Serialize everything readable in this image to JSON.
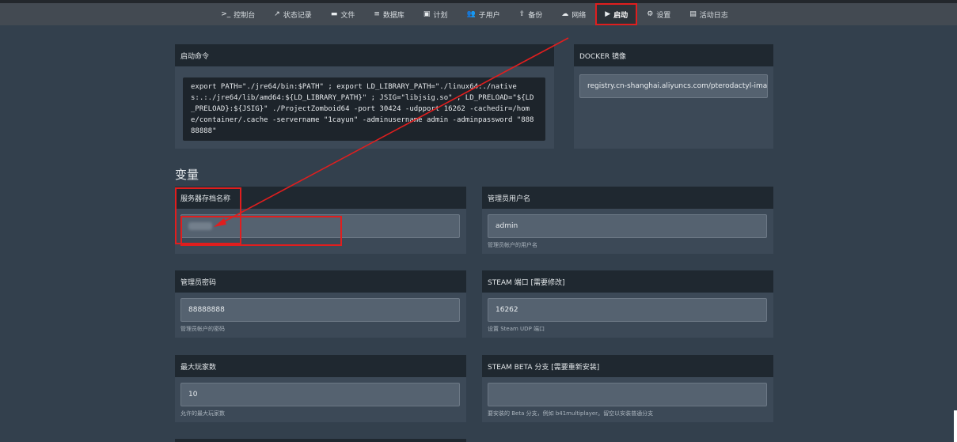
{
  "nav": {
    "items": [
      {
        "icon": ">_",
        "label": "控制台"
      },
      {
        "icon": "↗",
        "label": "状态记录"
      },
      {
        "icon": "▬",
        "label": "文件"
      },
      {
        "icon": "≡",
        "label": "数据库"
      },
      {
        "icon": "▣",
        "label": "计划"
      },
      {
        "icon": "👥",
        "label": "子用户"
      },
      {
        "icon": "⇪",
        "label": "备份"
      },
      {
        "icon": "☁",
        "label": "网络"
      },
      {
        "icon": "▶",
        "label": "启动"
      },
      {
        "icon": "⚙",
        "label": "设置"
      },
      {
        "icon": "▤",
        "label": "活动日志"
      }
    ],
    "active_index": 8
  },
  "startup": {
    "title": "启动命令",
    "command": "export PATH=\"./jre64/bin:$PATH\" ; export LD_LIBRARY_PATH=\"./linux64:./natives:.:./jre64/lib/amd64:${LD_LIBRARY_PATH}\" ; JSIG=\"libjsig.so\" ; LD_PRELOAD=\"${LD_PRELOAD}:${JSIG}\" ./ProjectZomboid64 -port 30424 -udpport 16262 -cachedir=/home/container/.cache -servername \"1cayun\" -adminusername admin -adminpassword \"88888888\""
  },
  "docker": {
    "title": "DOCKER 镜像",
    "value": "registry.cn-shanghai.aliyuncs.com/pterodactyl-image"
  },
  "variables": {
    "heading": "变量",
    "server_name": {
      "label": "服务器存档名称",
      "value": "",
      "help": ""
    },
    "admin_user": {
      "label": "管理员用户名",
      "value": "admin",
      "help": "管理员帐户的用户名"
    },
    "admin_pass": {
      "label": "管理员密码",
      "value": "88888888",
      "help": "管理员帐户的密码"
    },
    "steam_port": {
      "label": "STEAM 端口 [需要修改]",
      "value": "16262",
      "help": "设置 Steam UDP 端口"
    },
    "max_players": {
      "label": "最大玩家数",
      "value": "10",
      "help": "允许的最大玩家数"
    },
    "steam_beta": {
      "label": "STEAM BETA 分支 [需要重新安装]",
      "value": "",
      "help": "要安装的 Beta 分支，例如 b41multiplayer。留空以安装普通分支"
    }
  },
  "colors": {
    "accent_red": "#e01e1e",
    "background": "#33404d",
    "panel_header": "#1f2830"
  }
}
